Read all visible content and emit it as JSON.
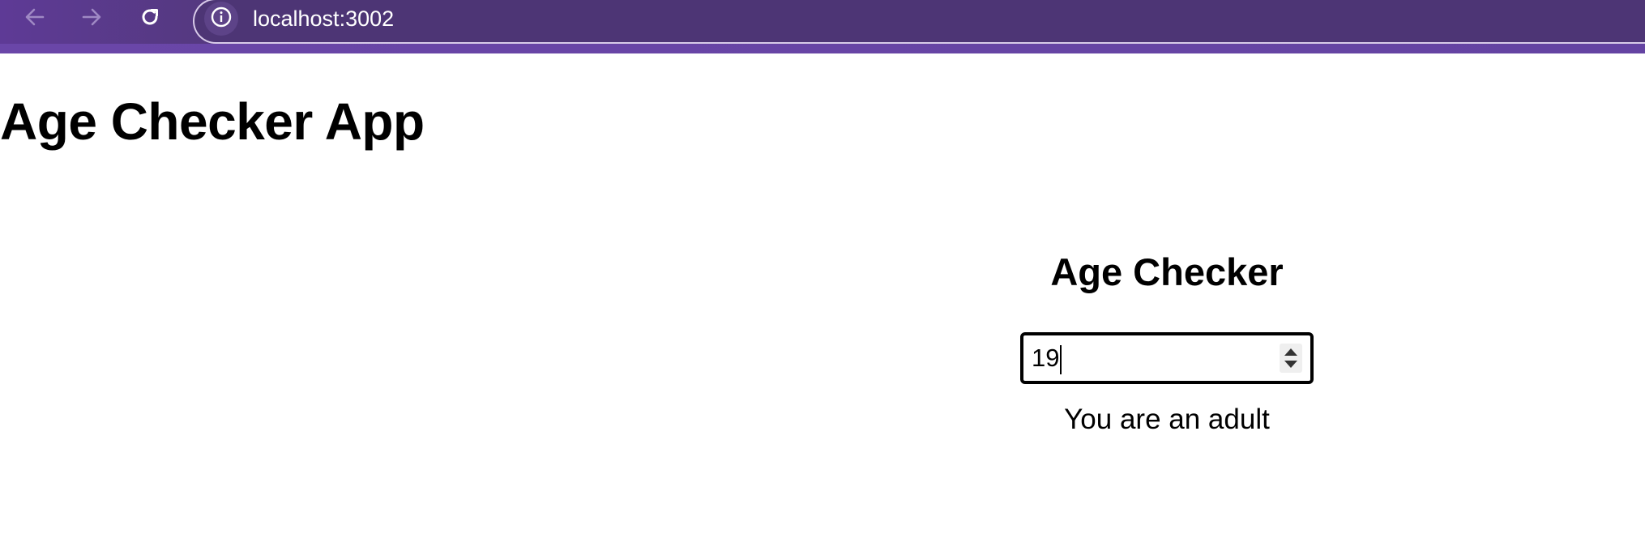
{
  "browser": {
    "url": "localhost:3002",
    "icons": {
      "back": "arrow-left-icon",
      "forward": "arrow-right-icon",
      "reload": "reload-icon",
      "site_info": "info-icon"
    },
    "colors": {
      "toolbar": "#553981",
      "accent_strip": "#6a46a8"
    }
  },
  "page": {
    "title": "Age Checker App"
  },
  "age_checker": {
    "heading": "Age Checker",
    "input_value": "19",
    "result": "You are an adult"
  }
}
